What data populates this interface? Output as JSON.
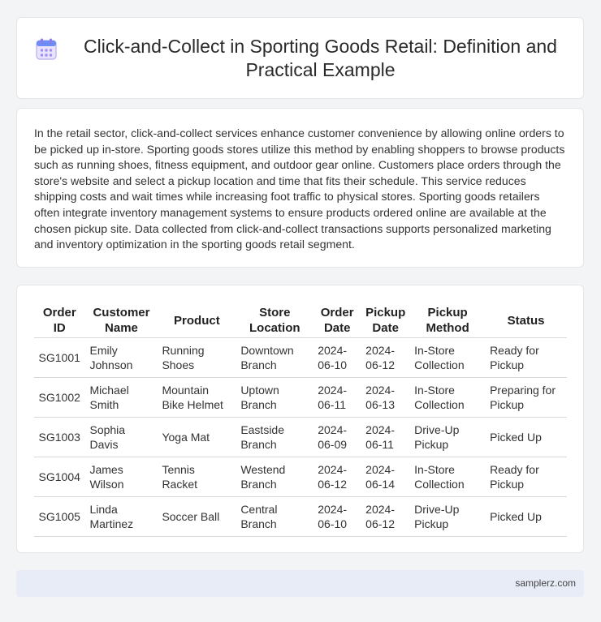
{
  "header": {
    "title": "Click-and-Collect in Sporting Goods Retail: Definition and Practical Example",
    "icon": "calendar-icon"
  },
  "description": "In the retail sector, click-and-collect services enhance customer convenience by allowing online orders to be picked up in-store. Sporting goods stores utilize this method by enabling shoppers to browse products such as running shoes, fitness equipment, and outdoor gear online. Customers place orders through the store's website and select a pickup location and time that fits their schedule. This service reduces shipping costs and wait times while increasing foot traffic to physical stores. Sporting goods retailers often integrate inventory management systems to ensure products ordered online are available at the chosen pickup site. Data collected from click-and-collect transactions supports personalized marketing and inventory optimization in the sporting goods retail segment.",
  "table": {
    "headers": [
      "Order ID",
      "Customer Name",
      "Product",
      "Store Location",
      "Order Date",
      "Pickup Date",
      "Pickup Method",
      "Status"
    ],
    "rows": [
      [
        "SG1001",
        "Emily Johnson",
        "Running Shoes",
        "Downtown Branch",
        "2024-06-10",
        "2024-06-12",
        "In-Store Collection",
        "Ready for Pickup"
      ],
      [
        "SG1002",
        "Michael Smith",
        "Mountain Bike Helmet",
        "Uptown Branch",
        "2024-06-11",
        "2024-06-13",
        "In-Store Collection",
        "Preparing for Pickup"
      ],
      [
        "SG1003",
        "Sophia Davis",
        "Yoga Mat",
        "Eastside Branch",
        "2024-06-09",
        "2024-06-11",
        "Drive-Up Pickup",
        "Picked Up"
      ],
      [
        "SG1004",
        "James Wilson",
        "Tennis Racket",
        "Westend Branch",
        "2024-06-12",
        "2024-06-14",
        "In-Store Collection",
        "Ready for Pickup"
      ],
      [
        "SG1005",
        "Linda Martinez",
        "Soccer Ball",
        "Central Branch",
        "2024-06-10",
        "2024-06-12",
        "Drive-Up Pickup",
        "Picked Up"
      ]
    ]
  },
  "footer": {
    "site": "samplerz.com"
  }
}
